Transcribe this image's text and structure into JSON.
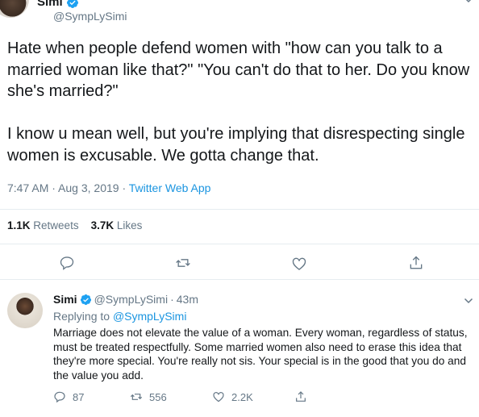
{
  "main_tweet": {
    "author_name": "Simi",
    "handle": "@SympLySimi",
    "text": "Hate when people defend women with \"how can you talk to a married woman like that?\" \"You can't do that to her. Do you know she's married?\"\n\nI know u mean well, but you're implying that disrespecting single women is excusable. We gotta change that.",
    "time": "7:47 AM",
    "date": "Aug 3, 2019",
    "separator": " · ",
    "source": "Twitter Web App",
    "retweets_count": "1.1K",
    "retweets_label": "Retweets",
    "likes_count": "3.7K",
    "likes_label": "Likes"
  },
  "reply_tweet": {
    "author_name": "Simi",
    "handle": "@SympLySimi",
    "separator": " · ",
    "age": "43m",
    "replying_prefix": "Replying to ",
    "replying_to": "@SympLySimi",
    "text": "Marriage does not elevate the value of a woman. Every woman, regardless of status, must be treated respectfully. Some married women also need to erase this idea that they're more special. You're really not sis. Your special is in the good that you do and the value you add.",
    "reply_count": "87",
    "retweet_count": "556",
    "like_count": "2.2K"
  },
  "icons": {
    "verified": "verified-badge-icon",
    "reply": "reply-icon",
    "retweet": "retweet-icon",
    "like": "heart-icon",
    "share": "share-icon",
    "chevron": "chevron-down-icon"
  },
  "colors": {
    "accent": "#1b95e0",
    "muted": "#657786",
    "text": "#14171a",
    "divider": "#e6ecf0"
  }
}
